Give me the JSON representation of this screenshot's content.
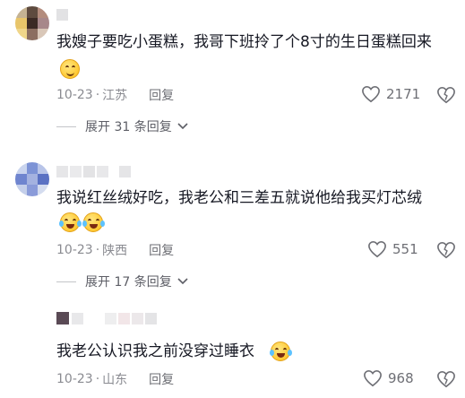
{
  "comments": [
    {
      "text": "我嫂子要吃小蛋糕，我哥下班拎了个8寸的生日蛋糕回来",
      "date": "10-23",
      "location": "江苏",
      "reply_label": "回复",
      "likes": "2171",
      "expand_label": "展开 31 条回复",
      "emoji": "smile-face"
    },
    {
      "text": "我说红丝绒好吃，我老公和三差五就说他给我买灯芯绒",
      "date": "10-23",
      "location": "陕西",
      "reply_label": "回复",
      "likes": "551",
      "expand_label": "展开 17 条回复",
      "emoji": "laughing-crying-face"
    },
    {
      "text": "我老公认识我之前没穿过睡衣",
      "date": "10-23",
      "location": "山东",
      "reply_label": "回复",
      "likes": "968",
      "emoji": "laughing-crying-face"
    }
  ],
  "separator": "·",
  "colors": {
    "text": "#161823",
    "meta": "#8a8b91",
    "emoji": "#ffc933"
  }
}
